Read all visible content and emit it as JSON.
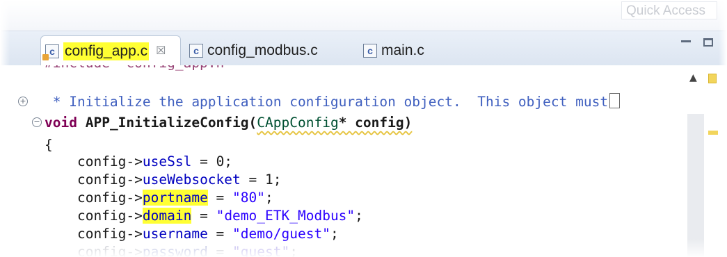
{
  "header": {
    "quick_access": "Quick Access"
  },
  "tabs": [
    {
      "label": "config_app.c",
      "icon": "c-source-file-icon",
      "active": true,
      "highlighted": true,
      "close": "☒"
    },
    {
      "label": "config_modbus.c",
      "icon": "c-source-file-icon",
      "active": false
    },
    {
      "label": "main.c",
      "icon": "c-source-file-icon",
      "active": false
    }
  ],
  "editor": {
    "include_line": "#include \"config_app.h\"",
    "comment_line": " * Initialize the application configuration object.  This object must",
    "signature": {
      "kw": "void",
      "name": "APP_InitializeConfig",
      "open": "(",
      "param_type": "CAppConfig",
      "param_rest": "* config)"
    },
    "brace": "{",
    "assignments": [
      {
        "prefix": "    config->",
        "field": "useSsl",
        "rest": " = 0;"
      },
      {
        "prefix": "    config->",
        "field": "useWebsocket",
        "rest": " = 1;"
      },
      {
        "prefix": "    config->",
        "field": "portname",
        "rest_eq": " = ",
        "value": "\"80\"",
        "end": ";"
      },
      {
        "prefix": "    config->",
        "field": "domain",
        "rest_eq": " = ",
        "value": "\"demo_ETK_Modbus\"",
        "end": ";"
      },
      {
        "prefix": "    config->",
        "field": "username",
        "rest_eq": " = ",
        "value": "\"demo/guest\"",
        "end": ";"
      },
      {
        "prefix": "    config->",
        "field": "password",
        "rest_eq": " = ",
        "value": "\"guest\"",
        "end": ";"
      }
    ]
  },
  "colors": {
    "highlight": "#ffff33",
    "keyword": "#7f0055",
    "field": "#0000c0",
    "string": "#2a00ff",
    "comment": "#3f5fbf"
  }
}
